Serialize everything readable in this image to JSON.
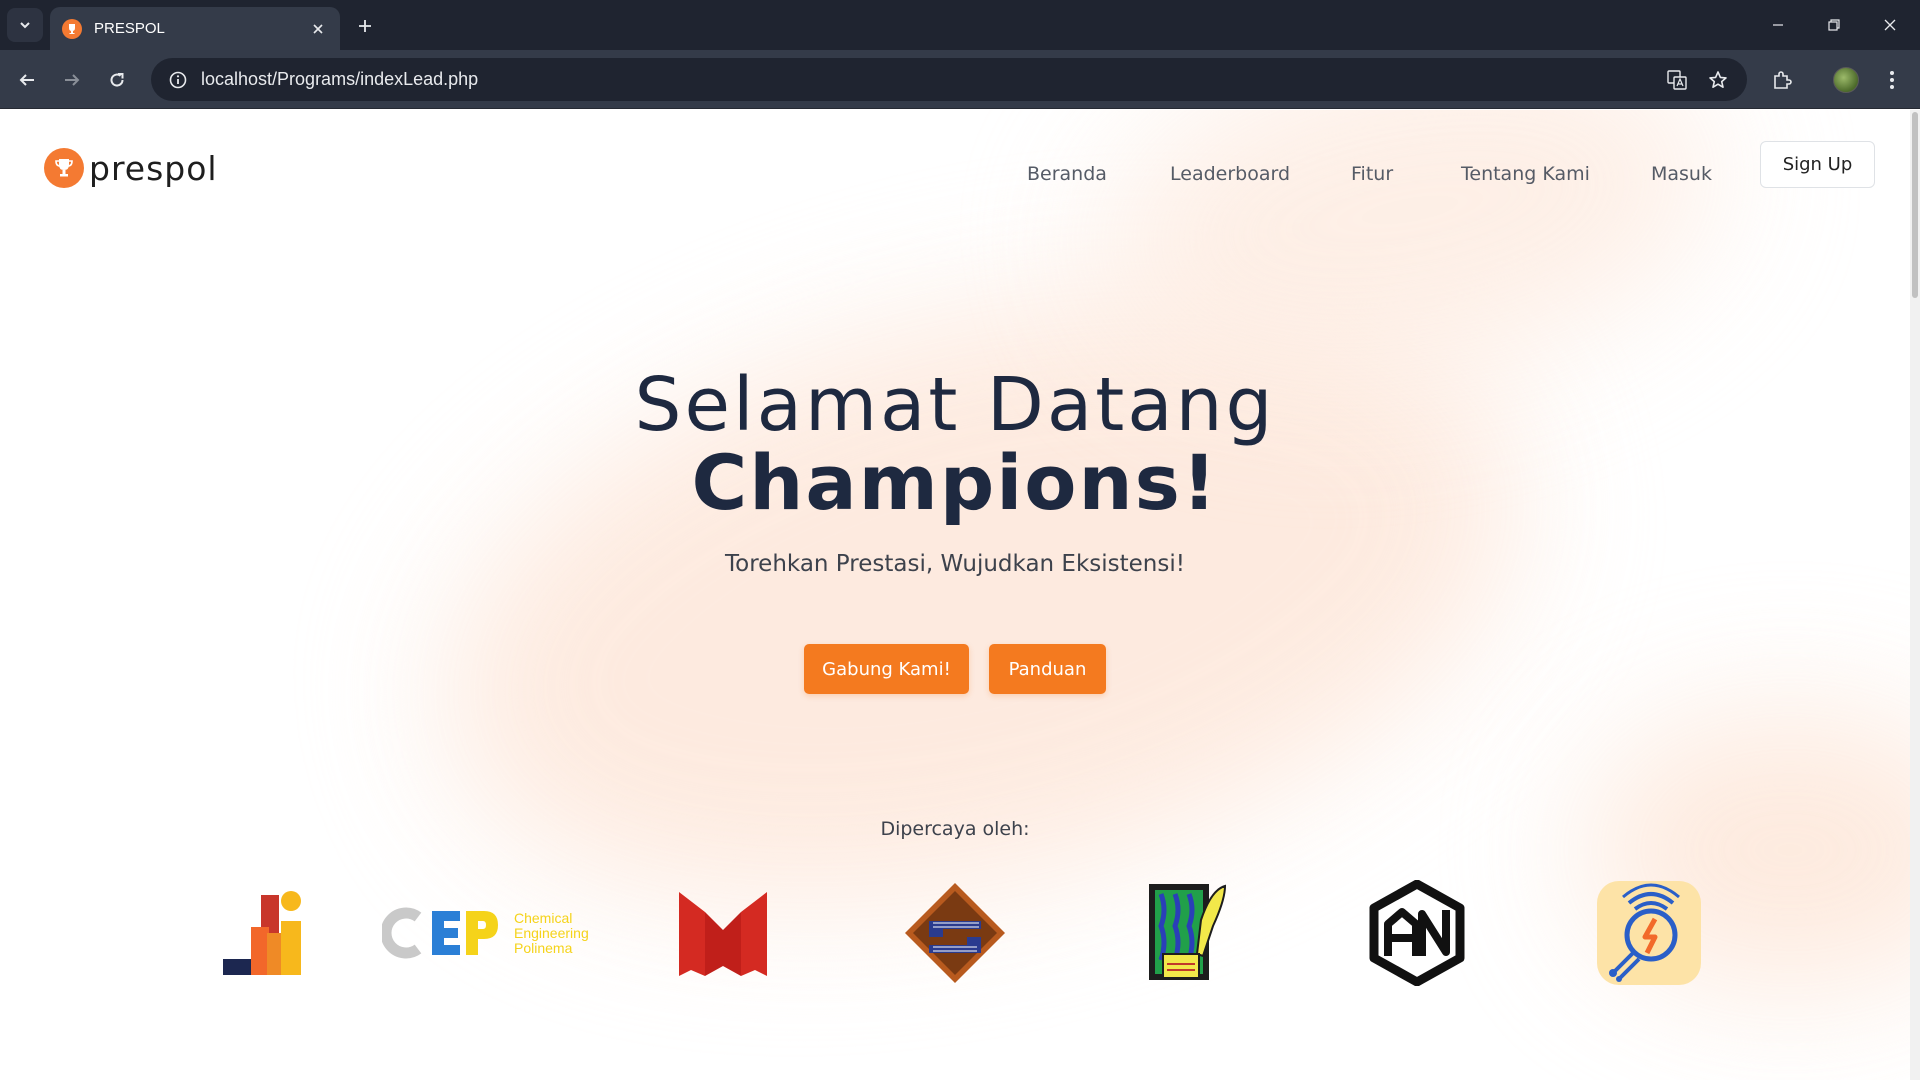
{
  "browser": {
    "tab_title": "PRESPOL",
    "url": "localhost/Programs/indexLead.php"
  },
  "site": {
    "logo_text": "prespol"
  },
  "nav": {
    "items": [
      "Beranda",
      "Leaderboard",
      "Fitur",
      "Tentang Kami",
      "Masuk"
    ],
    "signup": "Sign Up"
  },
  "hero": {
    "line1": "Selamat Datang",
    "line2": "Champions!",
    "subtitle": "Torehkan Prestasi, Wujudkan Eksistensi!",
    "primary_button": "Gabung Kami!",
    "secondary_button": "Panduan"
  },
  "trusted": {
    "label": "Dipercaya oleh:",
    "cep_text": "CEP",
    "cep_sub": [
      "Chemical",
      "Engineering",
      "Polinema"
    ]
  },
  "colors": {
    "accent": "#f47a1f",
    "heading": "#1e2940",
    "chrome_dark": "#1f2430",
    "chrome_bar": "#343b49"
  }
}
